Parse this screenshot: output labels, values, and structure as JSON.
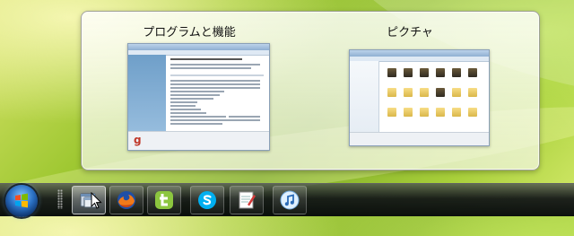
{
  "flyout": {
    "thumbnails": [
      {
        "title": "プログラムと機能"
      },
      {
        "title": "ピクチャ"
      }
    ]
  },
  "taskbar": {
    "start": {
      "icon": "windows-start-orb-icon"
    },
    "buttons": [
      {
        "icon": "explorer-window-icon",
        "active": true
      },
      {
        "icon": "firefox-icon"
      },
      {
        "icon": "green-leaf-app-icon"
      },
      {
        "icon": "skype-icon"
      },
      {
        "icon": "notepad-icon"
      },
      {
        "icon": "itunes-icon"
      }
    ]
  }
}
